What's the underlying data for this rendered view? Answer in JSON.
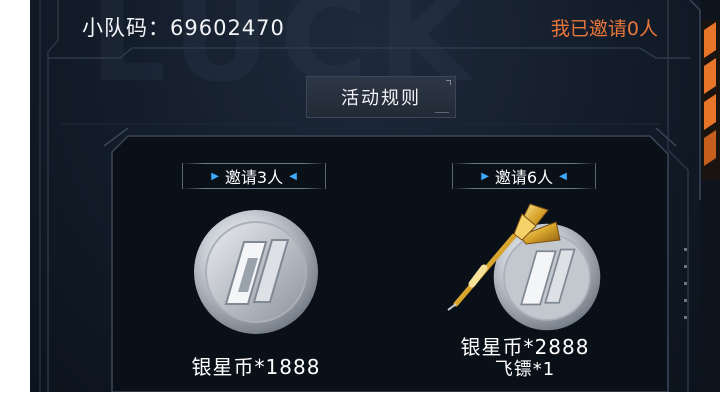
{
  "header": {
    "team_code": "小队码：69602470",
    "invited": "我已邀请0人"
  },
  "rules_button_label": "活动规则",
  "bg_watermark": "LUCK",
  "rewards": [
    {
      "tier": "邀请3人",
      "items": [
        "银星币*1888"
      ],
      "icons": [
        "silver-coin-icon"
      ]
    },
    {
      "tier": "邀请6人",
      "items": [
        "银星币*2888",
        "飞镖*1"
      ],
      "icons": [
        "silver-coin-icon",
        "gold-dart-icon"
      ]
    }
  ],
  "colors": {
    "background": "#0f1723",
    "invited_text": "#e8763a",
    "tier_arrow": "#3fa9ff",
    "side_accent": "#e8762a"
  }
}
